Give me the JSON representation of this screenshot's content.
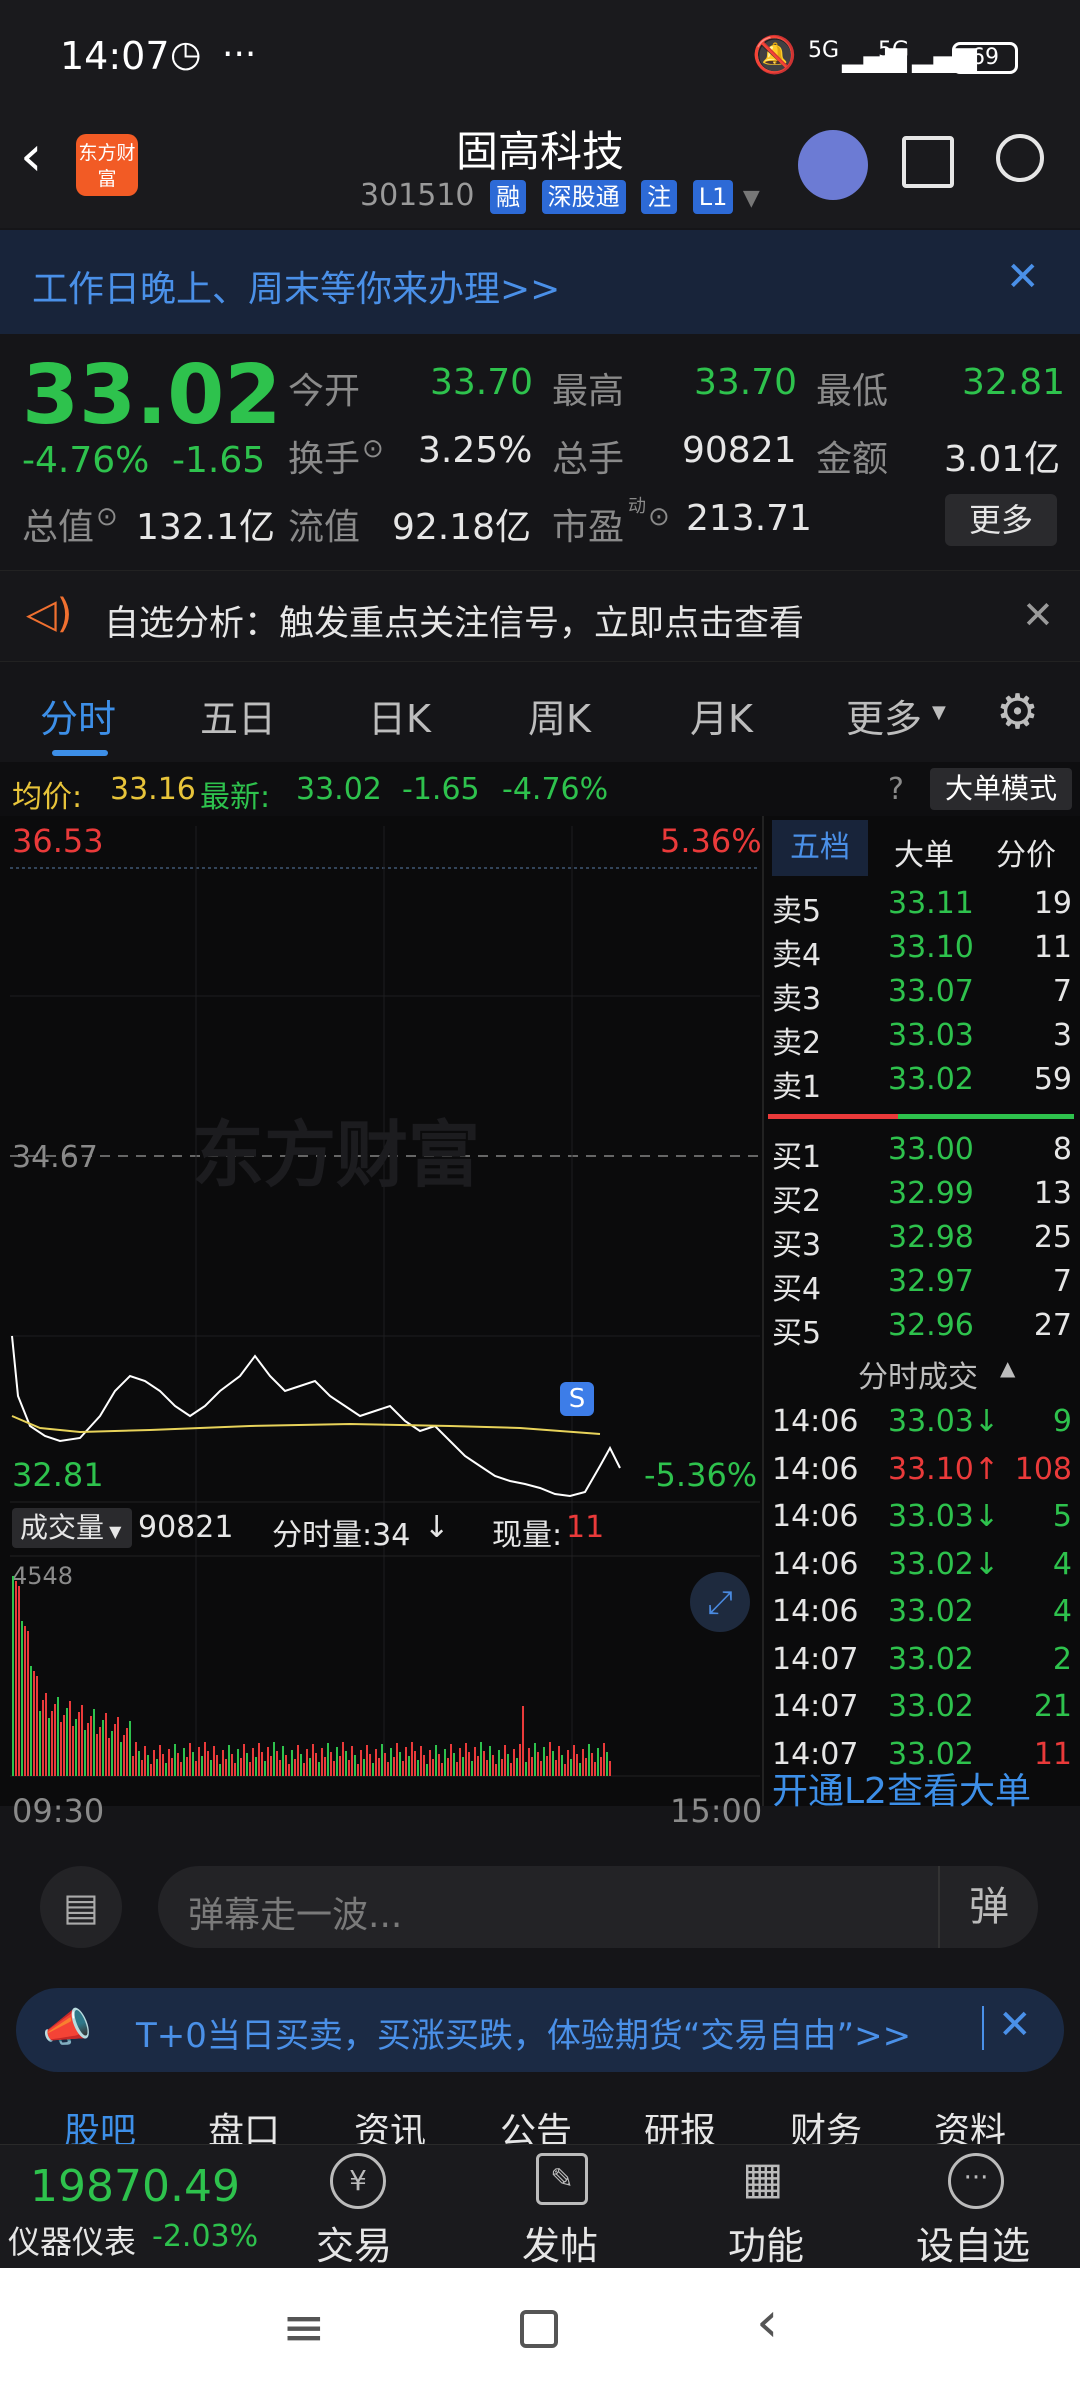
{
  "status": {
    "time": "14:07",
    "battery": "69",
    "net1": "5G",
    "net2": "5G"
  },
  "header": {
    "title": "固高科技",
    "code": "301510",
    "tags": [
      "融",
      "深股通",
      "注",
      "L1"
    ],
    "logo": "东方财富"
  },
  "banner1": {
    "text": "工作日晚上、周末等你来办理>>"
  },
  "quote": {
    "price": "33.02",
    "pct": "-4.76%",
    "chg": "-1.65",
    "open_l": "今开",
    "open": "33.70",
    "high_l": "最高",
    "high": "33.70",
    "low_l": "最低",
    "low": "32.81",
    "turn_l": "换手",
    "turn": "3.25%",
    "vol_l": "总手",
    "vol": "90821",
    "amt_l": "金额",
    "amt": "3.01亿",
    "mcap_l": "总值",
    "mcap": "132.1亿",
    "fcap_l": "流值",
    "fcap": "92.18亿",
    "pe_l": "市盈",
    "pe_sup": "动",
    "pe": "213.71",
    "more": "更多"
  },
  "notice": {
    "text": "自选分析：触发重点关注信号，立即点击查看"
  },
  "tabs": [
    "分时",
    "五日",
    "日K",
    "周K",
    "月K",
    "更多"
  ],
  "avgline": {
    "avg_l": "均价:",
    "avg": "33.16",
    "last_l": "最新:",
    "last": "33.02",
    "chg": "-1.65",
    "pct": "-4.76%",
    "mode": "大单模式"
  },
  "chart": {
    "top_price": "36.53",
    "top_pct": "5.36%",
    "mid": "34.67",
    "low_price": "32.81",
    "low_pct": "-5.36%",
    "watermark": "东方财富",
    "s_mark": "S",
    "vol_label": "成交量",
    "vol_total": "90821",
    "fs_label": "分时量:34",
    "now_label": "现量:",
    "now_val": "11",
    "vol_max": "4548",
    "t_start": "09:30",
    "t_end": "15:00"
  },
  "panel": {
    "tabs": [
      "五档",
      "大单",
      "分价"
    ],
    "asks": [
      {
        "l": "卖5",
        "p": "33.11",
        "v": "19"
      },
      {
        "l": "卖4",
        "p": "33.10",
        "v": "11"
      },
      {
        "l": "卖3",
        "p": "33.07",
        "v": "7"
      },
      {
        "l": "卖2",
        "p": "33.03",
        "v": "3"
      },
      {
        "l": "卖1",
        "p": "33.02",
        "v": "59"
      }
    ],
    "bids": [
      {
        "l": "买1",
        "p": "33.00",
        "v": "8"
      },
      {
        "l": "买2",
        "p": "32.99",
        "v": "13"
      },
      {
        "l": "买3",
        "p": "32.98",
        "v": "25"
      },
      {
        "l": "买4",
        "p": "32.97",
        "v": "7"
      },
      {
        "l": "买5",
        "p": "32.96",
        "v": "27"
      }
    ],
    "ticks_title": "分时成交",
    "ticks": [
      {
        "t": "14:06",
        "p": "33.03↓",
        "v": "9"
      },
      {
        "t": "14:06",
        "p": "33.10↑",
        "v": "108"
      },
      {
        "t": "14:06",
        "p": "33.03↓",
        "v": "5"
      },
      {
        "t": "14:06",
        "p": "33.02↓",
        "v": "4"
      },
      {
        "t": "14:06",
        "p": "33.02",
        "v": "4"
      },
      {
        "t": "14:07",
        "p": "33.02",
        "v": "2"
      },
      {
        "t": "14:07",
        "p": "33.02",
        "v": "21"
      },
      {
        "t": "14:07",
        "p": "33.02",
        "v": "11"
      }
    ],
    "l2": "开通L2查看大单"
  },
  "danmu": {
    "placeholder": "弹幕走一波...",
    "btn": "弹"
  },
  "banner2": {
    "text": "T+0当日买卖，买涨买跌，体验期货“交易自由”>>"
  },
  "subtabs": [
    "股吧",
    "盘口",
    "资讯",
    "公告",
    "研报",
    "财务",
    "资料"
  ],
  "bottom": {
    "index_val": "19870.49",
    "index_name": "仪器仪表",
    "index_pct": "-2.03%",
    "items": [
      "交易",
      "发帖",
      "功能",
      "设自选"
    ]
  }
}
